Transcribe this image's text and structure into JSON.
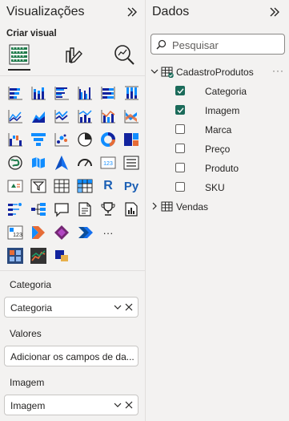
{
  "visualizations": {
    "title": "Visualizações",
    "build_label": "Criar visual",
    "tabs": [
      {
        "name": "build-visual",
        "selected": true
      },
      {
        "name": "format-visual",
        "selected": false
      },
      {
        "name": "analytics",
        "selected": false
      }
    ],
    "visual_types": [
      "stacked-bar-chart-icon",
      "stacked-column-chart-icon",
      "clustered-bar-chart-icon",
      "clustered-column-chart-icon",
      "100-stacked-bar-chart-icon",
      "100-stacked-column-chart-icon",
      "line-chart-icon",
      "area-chart-icon",
      "stacked-area-chart-icon",
      "line-and-column-chart-icon",
      "line-and-clustered-column-chart-icon",
      "ribbon-chart-icon",
      "waterfall-chart-icon",
      "funnel-chart-icon",
      "scatter-chart-icon",
      "pie-chart-icon",
      "donut-chart-icon",
      "treemap-icon",
      "map-icon",
      "filled-map-icon",
      "azure-map-icon",
      "gauge-icon",
      "card-icon",
      "multi-row-card-icon",
      "kpi-icon",
      "slicer-icon",
      "table-icon",
      "matrix-icon",
      "r-visual-icon",
      "python-visual-icon",
      "key-influencers-icon",
      "decomposition-tree-icon",
      "qa-icon",
      "smart-narrative-icon",
      "metrics-icon",
      "paginated-report-icon",
      "power-apps-icon",
      "power-automate-icon",
      "power-automate-flow-icon",
      "chevron-visual-icon",
      "more-visuals-icon"
    ],
    "r_label": "R",
    "py_label": "Py",
    "more_label": "···",
    "custom_visuals": [
      "custom-visual-grid-icon",
      "custom-visual-chart-icon",
      "custom-visual-image-icon"
    ],
    "wells": [
      {
        "heading": "Categoria",
        "value": "Categoria",
        "filled": true
      },
      {
        "heading": "Valores",
        "value": "Adicionar os campos de da...",
        "filled": false
      },
      {
        "heading": "Imagem",
        "value": "Imagem",
        "filled": true
      }
    ]
  },
  "data": {
    "title": "Dados",
    "search_placeholder": "Pesquisar",
    "tables": [
      {
        "name": "CadastroProdutos",
        "expanded": true,
        "more": "···",
        "fields": [
          {
            "label": "Categoria",
            "checked": true
          },
          {
            "label": "Imagem",
            "checked": true
          },
          {
            "label": "Marca",
            "checked": false
          },
          {
            "label": "Preço",
            "checked": false
          },
          {
            "label": "Produto",
            "checked": false
          },
          {
            "label": "SKU",
            "checked": false
          }
        ]
      },
      {
        "name": "Vendas",
        "expanded": false
      }
    ]
  },
  "colors": {
    "accent_check": "#1b6b5a",
    "pane_bg": "#f3f2f1",
    "blue": "#118dff",
    "dark_blue": "#12239e",
    "orange": "#e66c37"
  }
}
